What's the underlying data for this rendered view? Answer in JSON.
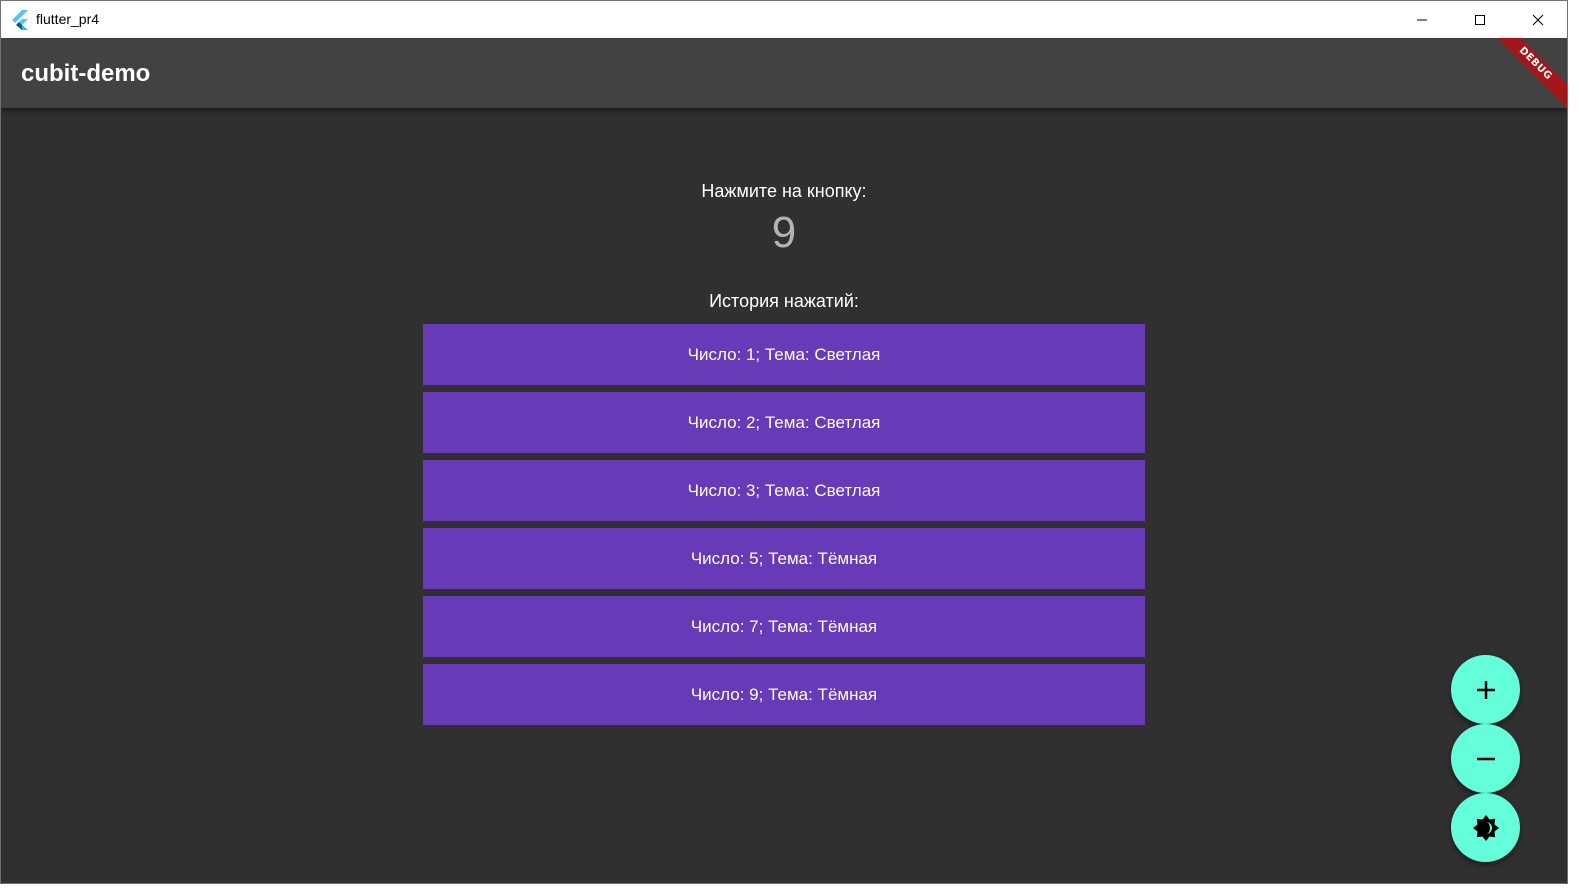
{
  "window": {
    "title": "flutter_pr4"
  },
  "appbar": {
    "title": "cubit-demo",
    "debug_banner": "DEBUG"
  },
  "counter": {
    "prompt": "Нажмите на кнопку:",
    "value": "9"
  },
  "history": {
    "label": "История нажатий:",
    "items": [
      "Число: 1; Тема: Светлая",
      "Число: 2; Тема: Светлая",
      "Число: 3; Тема: Светлая",
      "Число: 5; Тема: Тёмная",
      "Число: 7; Тема: Тёмная",
      "Число: 9; Тема: Тёмная"
    ]
  },
  "fabs": {
    "increment_icon": "plus-icon",
    "decrement_icon": "minus-icon",
    "theme_icon": "brightness-icon"
  },
  "colors": {
    "background": "#303030",
    "appbar": "#424242",
    "list_item": "#673ab7",
    "fab": "#64ffda",
    "debug_banner": "#a4161a"
  }
}
